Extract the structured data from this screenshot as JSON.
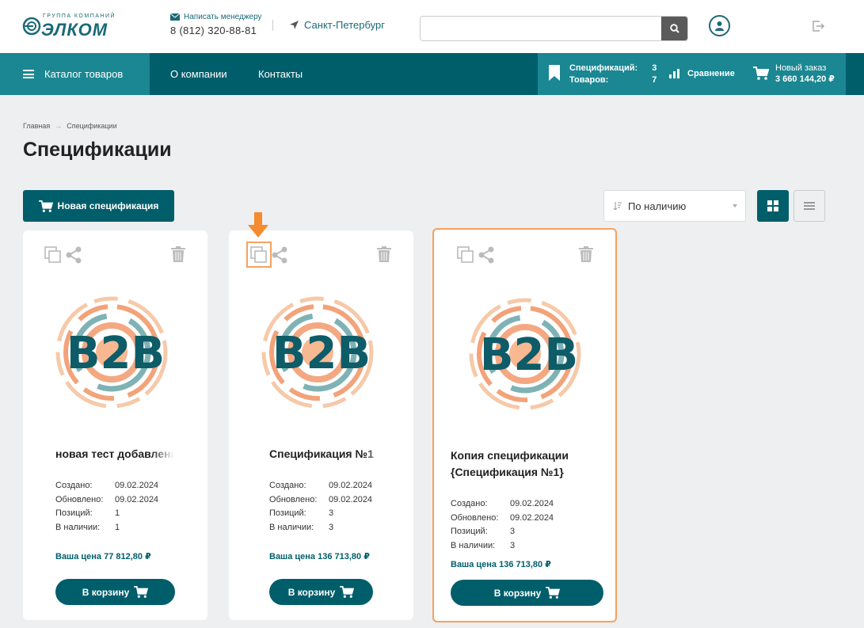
{
  "header": {
    "logo_small": "ГРУППА КОМПАНИЙ",
    "logo_big": "ЭЛКОМ",
    "mail_label": "Написать менеджеру",
    "phone": "8 (812) 320-88-81",
    "city": "Санкт-Петербург",
    "search_placeholder": ""
  },
  "nav": {
    "catalog": "Каталог товаров",
    "about": "О компании",
    "contacts": "Контакты",
    "spec_label": "Спецификаций:",
    "spec_count": "3",
    "goods_label": "Товаров:",
    "goods_count": "7",
    "compare": "Сравнение",
    "order_label": "Новый заказ",
    "order_sum": "3 660 144,20 ₽"
  },
  "breadcrumb": {
    "home": "Главная",
    "arrow": "→",
    "current": "Спецификации"
  },
  "page_title": "Спецификации",
  "toolbar": {
    "new_spec": "Новая спецификация",
    "sort_value": "По наличию"
  },
  "labels": {
    "created": "Создано:",
    "updated": "Обновлено:",
    "positions": "Позиций:",
    "in_stock": "В наличии:",
    "cart": "В корзину",
    "logo_text": "B2B"
  },
  "cards": [
    {
      "name": "новая тест добавления",
      "created": "09.02.2024",
      "updated": "09.02.2024",
      "positions": "1",
      "in_stock": "1",
      "price": "Ваша цена 77 812,80 ₽"
    },
    {
      "name": "Спецификация №1",
      "created": "09.02.2024",
      "updated": "09.02.2024",
      "positions": "3",
      "in_stock": "3",
      "price": "Ваша цена 136 713,80 ₽"
    },
    {
      "name": "Копия спецификации {Спецификация №1}",
      "created": "09.02.2024",
      "updated": "09.02.2024",
      "positions": "3",
      "in_stock": "3",
      "price": "Ваша цена 136 713,80 ₽"
    }
  ],
  "colors": {
    "primary": "#005e6b",
    "accent": "#1a8792",
    "highlight": "#f4a261"
  }
}
